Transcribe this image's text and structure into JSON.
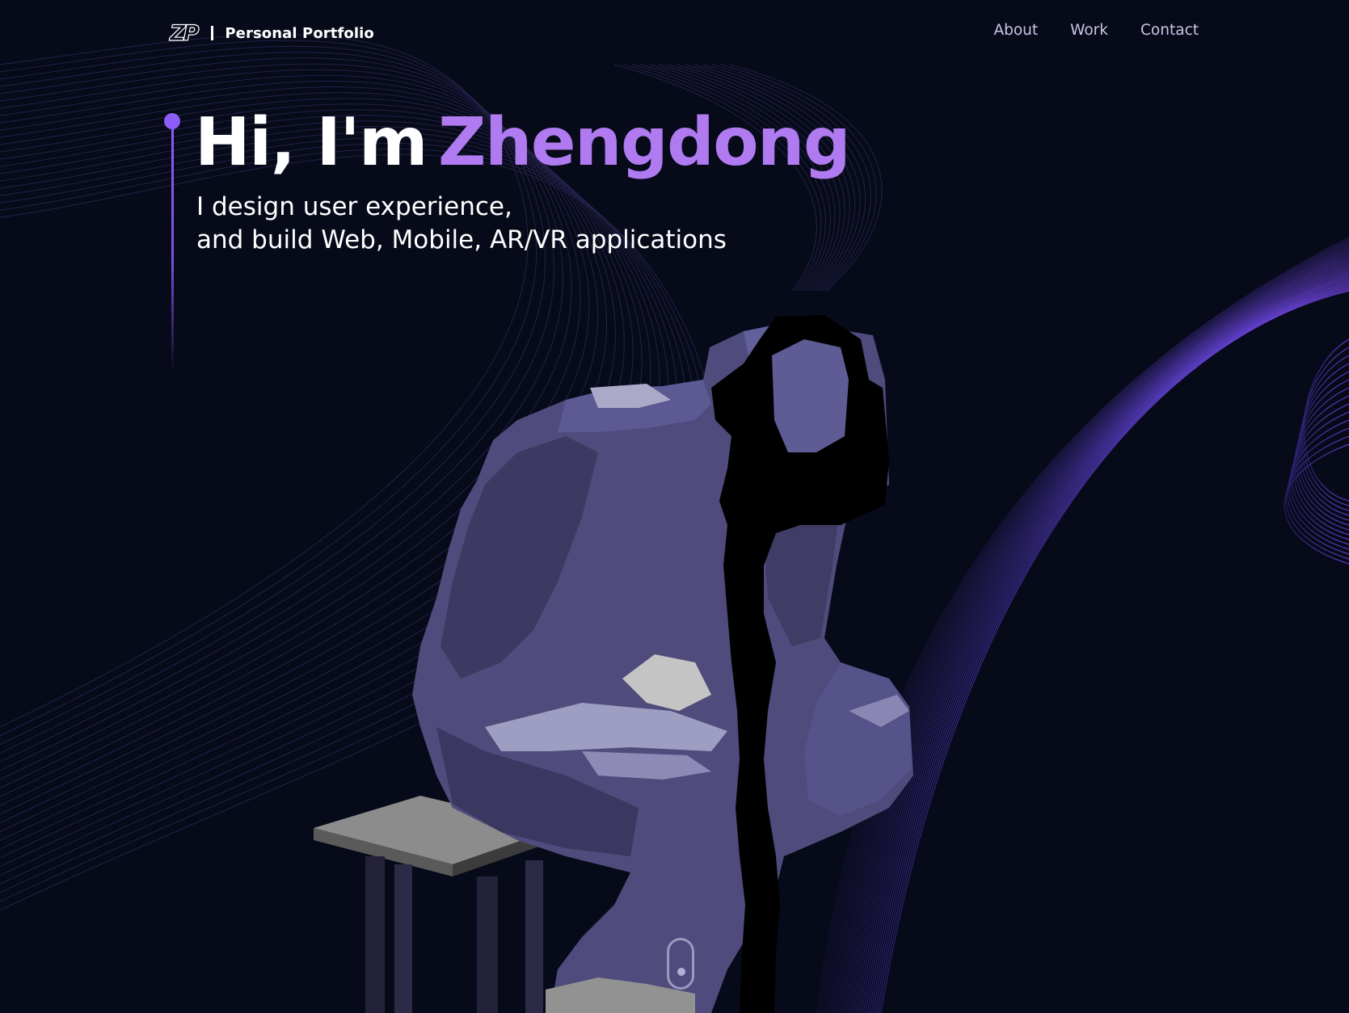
{
  "header": {
    "logo": "ZP",
    "title": "Personal Portfolio",
    "nav": [
      "About",
      "Work",
      "Contact"
    ]
  },
  "hero": {
    "greeting": "Hi, I'm",
    "name": "Zhengdong",
    "tagline_line1": "I design user experience,",
    "tagline_line2": "and build Web, Mobile, AR/VR applications"
  },
  "colors": {
    "background": "#070a19",
    "accent": "#b07af0",
    "dot": "#8b5cf6",
    "figure": "#4f4b7c",
    "nav_text": "#c9c6e6"
  },
  "icons": {
    "scroll": "mouse-scroll-icon",
    "logo": "zp-logo-icon"
  }
}
